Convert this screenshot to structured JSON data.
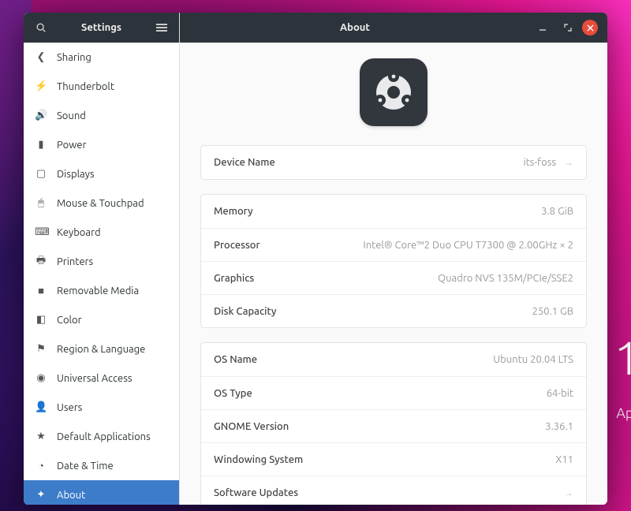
{
  "wallpaper": {
    "clock_fragment": "1",
    "date_fragment": "Apr"
  },
  "window": {
    "app_title": "Settings",
    "page_title": "About"
  },
  "sidebar": {
    "items": [
      {
        "icon": "share",
        "label": "Sharing"
      },
      {
        "icon": "bolt",
        "label": "Thunderbolt"
      },
      {
        "icon": "sound",
        "label": "Sound"
      },
      {
        "icon": "power",
        "label": "Power"
      },
      {
        "icon": "display",
        "label": "Displays"
      },
      {
        "icon": "mouse",
        "label": "Mouse & Touchpad"
      },
      {
        "icon": "keyboard",
        "label": "Keyboard"
      },
      {
        "icon": "printer",
        "label": "Printers"
      },
      {
        "icon": "media",
        "label": "Removable Media"
      },
      {
        "icon": "color",
        "label": "Color"
      },
      {
        "icon": "region",
        "label": "Region & Language"
      },
      {
        "icon": "access",
        "label": "Universal Access"
      },
      {
        "icon": "users",
        "label": "Users"
      },
      {
        "icon": "star",
        "label": "Default Applications"
      },
      {
        "icon": "clock",
        "label": "Date & Time"
      },
      {
        "icon": "plus",
        "label": "About"
      }
    ],
    "active_index": 15
  },
  "about": {
    "device_name": {
      "label": "Device Name",
      "value": "its-foss"
    },
    "hardware": {
      "memory": {
        "label": "Memory",
        "value": "3.8 GiB"
      },
      "processor": {
        "label": "Processor",
        "value": "Intel® Core™2 Duo CPU T7300 @ 2.00GHz × 2"
      },
      "graphics": {
        "label": "Graphics",
        "value": "Quadro NVS 135M/PCIe/SSE2"
      },
      "disk": {
        "label": "Disk Capacity",
        "value": "250.1 GB"
      }
    },
    "software": {
      "os_name": {
        "label": "OS Name",
        "value": "Ubuntu 20.04 LTS"
      },
      "os_type": {
        "label": "OS Type",
        "value": "64-bit"
      },
      "gnome": {
        "label": "GNOME Version",
        "value": "3.36.1"
      },
      "windowing": {
        "label": "Windowing System",
        "value": "X11"
      },
      "updates": {
        "label": "Software Updates",
        "value": ""
      }
    }
  },
  "icons": {
    "share": "❮",
    "bolt": "⚡",
    "sound": "🔊",
    "power": "▮",
    "display": "▢",
    "mouse": "🖱",
    "keyboard": "⌨",
    "printer": "🖶",
    "media": "■",
    "color": "◧",
    "region": "⚑",
    "access": "◉",
    "users": "👤",
    "star": "★",
    "clock": "◔",
    "plus": "✦"
  }
}
